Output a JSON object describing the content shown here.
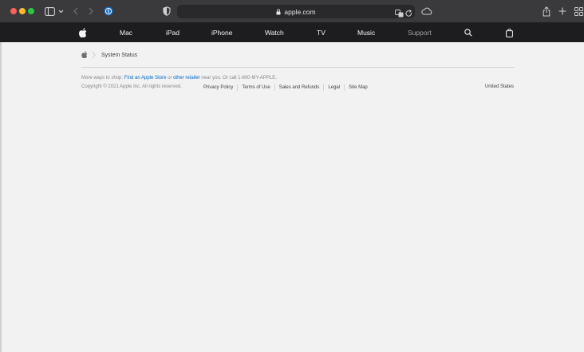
{
  "browser": {
    "url": "apple.com",
    "icons": {
      "sidebar": "sidebar-icon",
      "back": "chevron-left-icon",
      "forward": "chevron-right-icon",
      "password": "password-manager-icon",
      "privacy": "shield-icon",
      "lock": "lock-icon",
      "translate": "translate-icon",
      "reload": "reload-icon",
      "icloud": "cloud-icon",
      "share": "share-icon",
      "new_tab": "plus-icon",
      "tab_overview": "tab-overview-icon"
    }
  },
  "nav": {
    "items": [
      "Mac",
      "iPad",
      "iPhone",
      "Watch",
      "TV",
      "Music",
      "Support"
    ]
  },
  "breadcrumb": {
    "current": "System Status"
  },
  "footer": {
    "shop_prefix": "More ways to shop: ",
    "find_store": "Find an Apple Store",
    "or_text": " or ",
    "other_retailer": "other retailer",
    "shop_suffix": " near you. Or call 1-800-MY-APPLE.",
    "copyright": "Copyright © 2021 Apple Inc. All rights reserved.",
    "links": [
      "Privacy Policy",
      "Terms of Use",
      "Sales and Refunds",
      "Legal",
      "Site Map"
    ],
    "country": "United States"
  },
  "colors": {
    "nav_bg": "#1d1d1f",
    "page_bg": "#f2f2f2",
    "link": "#0066cc"
  }
}
